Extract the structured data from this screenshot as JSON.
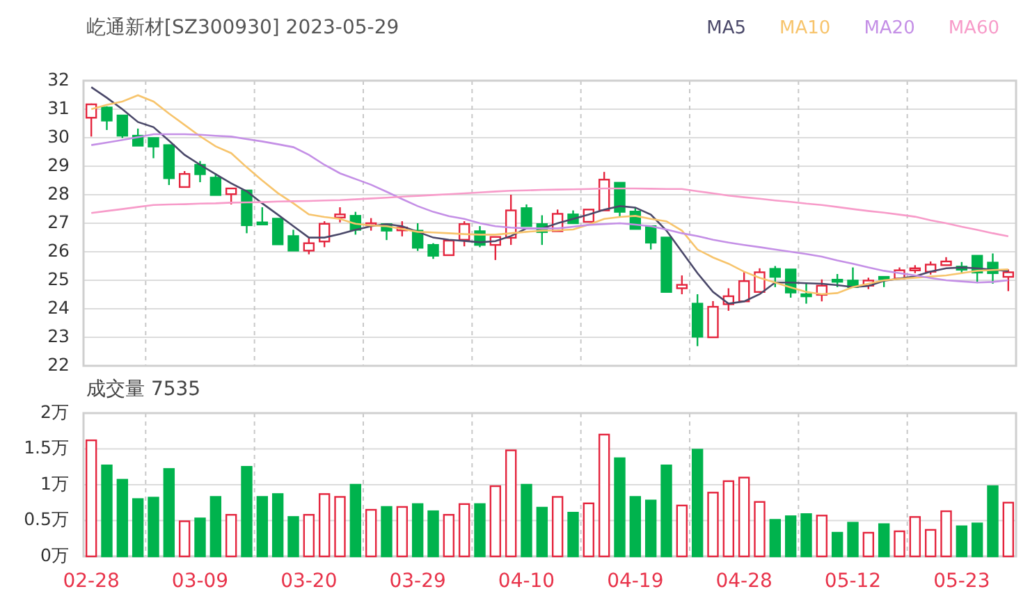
{
  "price_chart": {
    "chart_data": {
      "type": "candlestick",
      "title": "屹通新材[SZ300930] 2023-05-29",
      "grid": true,
      "ylim": [
        22,
        32
      ],
      "yticks": [
        22,
        23,
        24,
        25,
        26,
        27,
        28,
        29,
        30,
        31,
        32
      ],
      "categories": [
        null,
        null,
        null,
        null,
        null,
        null,
        null,
        null,
        null,
        null,
        null,
        null,
        null,
        null,
        null,
        null,
        null,
        null,
        null,
        null,
        null,
        null,
        null,
        null,
        null,
        null,
        null,
        null,
        null,
        null,
        null,
        null,
        null,
        null,
        null,
        null,
        null,
        null,
        null,
        null,
        null,
        null,
        null,
        null,
        null,
        null,
        null,
        null,
        null,
        null,
        null,
        null,
        null,
        null,
        null,
        null,
        null,
        null,
        null,
        null
      ],
      "ohlc": [
        [
          30.7,
          31.2,
          30.04,
          31.17
        ],
        [
          31.06,
          31.1,
          30.27,
          30.6
        ],
        [
          30.78,
          30.8,
          29.99,
          30.07
        ],
        [
          30.07,
          30.32,
          29.72,
          29.72
        ],
        [
          29.99,
          30.0,
          29.28,
          29.69
        ],
        [
          29.74,
          29.76,
          28.34,
          28.58
        ],
        [
          28.27,
          28.83,
          28.27,
          28.73
        ],
        [
          29.05,
          29.18,
          28.44,
          28.72
        ],
        [
          28.6,
          28.75,
          27.99,
          27.99
        ],
        [
          28.02,
          28.22,
          27.66,
          28.22
        ],
        [
          28.15,
          28.15,
          26.65,
          26.93
        ],
        [
          27.03,
          27.56,
          27.0,
          27.0
        ],
        [
          27.16,
          27.16,
          26.26,
          26.26
        ],
        [
          26.55,
          26.77,
          26.04,
          26.04
        ],
        [
          26.04,
          26.5,
          25.91,
          26.3
        ],
        [
          26.36,
          27.07,
          26.16,
          26.98
        ],
        [
          27.2,
          27.56,
          27.03,
          27.31
        ],
        [
          27.26,
          27.4,
          26.6,
          26.77
        ],
        [
          26.93,
          27.18,
          26.74,
          27.0
        ],
        [
          26.97,
          26.97,
          26.41,
          26.74
        ],
        [
          26.75,
          27.07,
          26.54,
          26.85
        ],
        [
          26.74,
          27.0,
          26.03,
          26.14
        ],
        [
          26.24,
          26.3,
          25.75,
          25.86
        ],
        [
          25.88,
          26.39,
          25.88,
          26.39
        ],
        [
          26.42,
          27.07,
          26.19,
          26.97
        ],
        [
          26.72,
          26.9,
          26.16,
          26.24
        ],
        [
          26.24,
          26.52,
          25.71,
          26.52
        ],
        [
          26.49,
          28.0,
          26.24,
          27.45
        ],
        [
          27.53,
          27.66,
          26.9,
          26.9
        ],
        [
          26.97,
          27.28,
          26.24,
          26.69
        ],
        [
          26.72,
          27.48,
          26.72,
          27.33
        ],
        [
          27.31,
          27.45,
          27.0,
          27.0
        ],
        [
          27.05,
          27.48,
          27.05,
          27.48
        ],
        [
          27.45,
          28.8,
          27.45,
          28.53
        ],
        [
          28.42,
          28.42,
          27.23,
          27.4
        ],
        [
          27.41,
          27.56,
          26.8,
          26.8
        ],
        [
          26.9,
          26.9,
          26.08,
          26.32
        ],
        [
          26.5,
          26.5,
          24.59,
          24.59
        ],
        [
          24.72,
          25.17,
          24.51,
          24.84
        ],
        [
          24.18,
          24.51,
          22.69,
          23.02
        ],
        [
          23.0,
          24.27,
          23.0,
          24.07
        ],
        [
          24.16,
          24.72,
          23.93,
          24.44
        ],
        [
          24.26,
          25.3,
          24.26,
          24.97
        ],
        [
          24.59,
          25.42,
          24.59,
          25.28
        ],
        [
          25.4,
          25.5,
          24.76,
          25.12
        ],
        [
          25.38,
          25.38,
          24.39,
          24.57
        ],
        [
          24.51,
          24.89,
          24.18,
          24.44
        ],
        [
          24.49,
          25.03,
          24.26,
          24.81
        ],
        [
          25.02,
          25.22,
          24.76,
          24.95
        ],
        [
          24.99,
          25.45,
          24.76,
          24.76
        ],
        [
          24.81,
          25.09,
          24.69,
          24.99
        ],
        [
          25.12,
          25.12,
          24.76,
          25.04
        ],
        [
          25.06,
          25.45,
          25.02,
          25.35
        ],
        [
          25.35,
          25.53,
          25.25,
          25.42
        ],
        [
          25.3,
          25.66,
          25.2,
          25.55
        ],
        [
          25.53,
          25.81,
          25.53,
          25.66
        ],
        [
          25.48,
          25.64,
          25.22,
          25.37
        ],
        [
          25.86,
          25.86,
          24.9,
          25.27
        ],
        [
          25.62,
          25.94,
          24.88,
          25.25
        ],
        [
          25.12,
          25.38,
          24.62,
          25.28
        ]
      ]
    }
  },
  "moving_averages": {
    "chart_data": {
      "type": "line",
      "ylim": [
        22,
        32
      ],
      "categories": [
        null,
        null,
        null,
        null,
        null,
        null,
        null,
        null,
        null,
        null,
        null,
        null,
        null,
        null,
        null,
        null,
        null,
        null,
        null,
        null,
        null,
        null,
        null,
        null,
        null,
        null,
        null,
        null,
        null,
        null,
        null,
        null,
        null,
        null,
        null,
        null,
        null,
        null,
        null,
        null,
        null,
        null,
        null,
        null,
        null,
        null,
        null,
        null,
        null,
        null,
        null,
        null,
        null,
        null,
        null,
        null,
        null,
        null,
        null,
        null
      ],
      "series": [
        {
          "name": "MA5",
          "color": "#4a4869",
          "values": [
            31.77,
            31.4,
            31.0,
            30.55,
            30.37,
            29.9,
            29.4,
            29.05,
            28.72,
            28.4,
            28.12,
            27.7,
            27.3,
            26.9,
            26.5,
            26.5,
            26.62,
            26.77,
            26.9,
            26.97,
            26.9,
            26.7,
            26.5,
            26.42,
            26.38,
            26.33,
            26.37,
            26.55,
            26.82,
            26.82,
            27.0,
            27.15,
            27.3,
            27.48,
            27.6,
            27.55,
            27.3,
            26.74,
            26.0,
            25.25,
            24.59,
            24.18,
            24.26,
            24.51,
            24.92,
            24.92,
            24.9,
            24.88,
            24.83,
            24.76,
            24.8,
            24.98,
            25.06,
            25.14,
            25.3,
            25.42,
            25.45,
            25.42,
            25.37,
            25.32
          ]
        },
        {
          "name": "MA10",
          "color": "#f7c46c",
          "values": [
            31.0,
            31.15,
            31.27,
            31.49,
            31.27,
            30.85,
            30.45,
            30.05,
            29.7,
            29.46,
            28.96,
            28.5,
            28.06,
            27.7,
            27.31,
            27.22,
            27.15,
            26.98,
            26.92,
            26.9,
            26.8,
            26.7,
            26.68,
            26.65,
            26.62,
            26.6,
            26.6,
            26.65,
            26.7,
            26.74,
            26.75,
            26.78,
            26.95,
            27.15,
            27.22,
            27.26,
            27.15,
            27.07,
            26.74,
            26.08,
            25.8,
            25.58,
            25.3,
            25.09,
            24.92,
            24.75,
            24.59,
            24.51,
            24.55,
            24.76,
            24.88,
            25.0,
            25.05,
            25.09,
            25.13,
            25.17,
            25.25,
            25.33,
            25.36,
            25.38
          ]
        },
        {
          "name": "MA20",
          "color": "#c48fe6",
          "values": [
            29.74,
            29.83,
            29.92,
            30.02,
            30.12,
            30.12,
            30.12,
            30.1,
            30.07,
            30.04,
            29.95,
            29.87,
            29.77,
            29.67,
            29.4,
            29.05,
            28.75,
            28.55,
            28.35,
            28.1,
            27.85,
            27.6,
            27.4,
            27.25,
            27.15,
            27.0,
            26.9,
            26.85,
            26.82,
            26.82,
            26.82,
            26.88,
            26.94,
            26.97,
            27.0,
            26.95,
            26.9,
            26.78,
            26.65,
            26.55,
            26.42,
            26.32,
            26.24,
            26.16,
            26.08,
            26.0,
            25.92,
            25.83,
            25.7,
            25.58,
            25.45,
            25.33,
            25.25,
            25.17,
            25.08,
            25.0,
            24.96,
            24.92,
            24.94,
            25.0
          ]
        },
        {
          "name": "MA60",
          "color": "#f79bc9",
          "values": [
            27.36,
            27.43,
            27.5,
            27.57,
            27.64,
            27.66,
            27.67,
            27.69,
            27.7,
            27.72,
            27.73,
            27.74,
            27.76,
            27.77,
            27.78,
            27.8,
            27.81,
            27.84,
            27.87,
            27.9,
            27.93,
            27.96,
            27.99,
            28.02,
            28.05,
            28.08,
            28.11,
            28.14,
            28.15,
            28.17,
            28.18,
            28.19,
            28.2,
            28.22,
            28.22,
            28.22,
            28.21,
            28.2,
            28.2,
            28.12,
            28.05,
            27.97,
            27.91,
            27.86,
            27.8,
            27.75,
            27.69,
            27.64,
            27.57,
            27.5,
            27.43,
            27.37,
            27.3,
            27.23,
            27.1,
            27.0,
            26.88,
            26.77,
            26.65,
            26.54
          ]
        }
      ]
    }
  },
  "volume_chart": {
    "chart_data": {
      "type": "bar",
      "title": "成交量 7535",
      "grid": true,
      "ylim": [
        0,
        2
      ],
      "categories": [
        "02-28",
        null,
        null,
        null,
        null,
        null,
        null,
        "03-09",
        null,
        null,
        null,
        null,
        null,
        null,
        "03-20",
        null,
        null,
        null,
        null,
        null,
        null,
        "03-29",
        null,
        null,
        null,
        null,
        null,
        null,
        "04-10",
        null,
        null,
        null,
        null,
        null,
        null,
        "04-19",
        null,
        null,
        null,
        null,
        null,
        null,
        "04-28",
        null,
        null,
        null,
        null,
        null,
        null,
        "05-12",
        null,
        null,
        null,
        null,
        null,
        null,
        "05-23",
        null,
        null,
        null
      ],
      "yticks": [
        {
          "value": 0,
          "label": "0万"
        },
        {
          "value": 0.5,
          "label": "0.5万"
        },
        {
          "value": 1,
          "label": "1万"
        },
        {
          "value": 1.5,
          "label": "1.5万"
        },
        {
          "value": 2,
          "label": "2万"
        }
      ],
      "values": [
        1.62,
        1.27,
        1.07,
        0.8,
        0.82,
        1.22,
        0.49,
        0.53,
        0.83,
        0.58,
        1.25,
        0.83,
        0.87,
        0.55,
        0.58,
        0.87,
        0.83,
        1.0,
        0.65,
        0.69,
        0.69,
        0.73,
        0.63,
        0.58,
        0.73,
        0.73,
        0.98,
        1.48,
        1.0,
        0.68,
        0.83,
        0.61,
        0.74,
        1.7,
        1.37,
        0.83,
        0.78,
        1.27,
        0.71,
        1.49,
        0.89,
        1.05,
        1.1,
        0.76,
        0.51,
        0.56,
        0.59,
        0.57,
        0.33,
        0.47,
        0.33,
        0.45,
        0.35,
        0.55,
        0.37,
        0.63,
        0.42,
        0.46,
        0.98,
        0.75
      ]
    }
  }
}
